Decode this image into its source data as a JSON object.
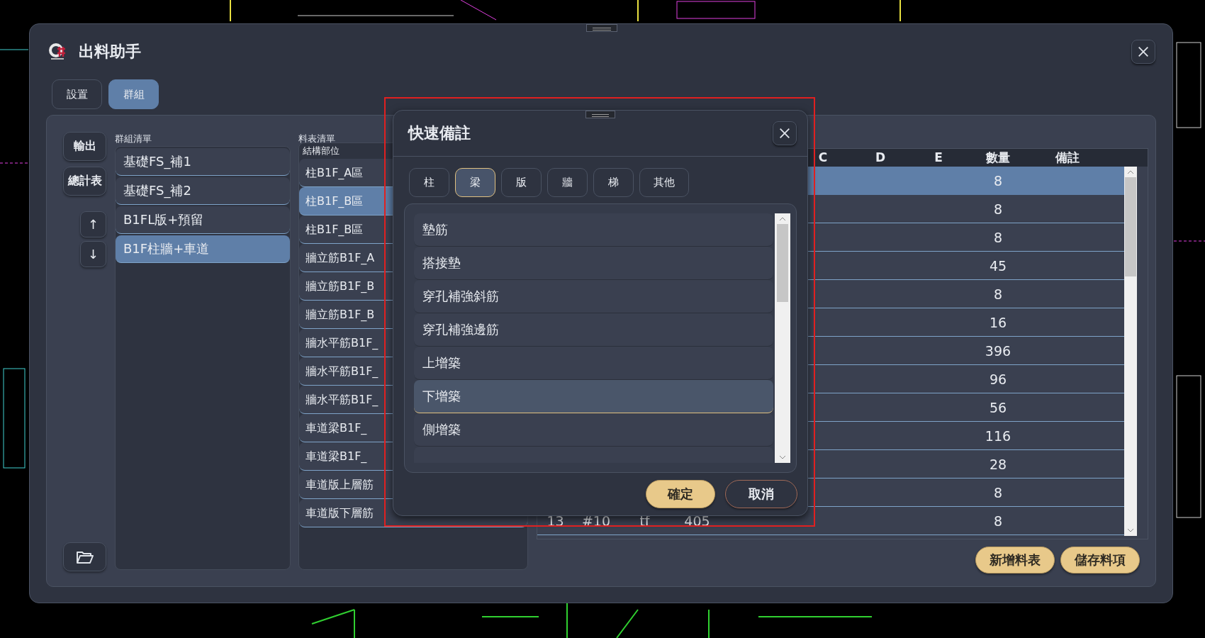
{
  "window": {
    "title": "出料助手"
  },
  "tabs": [
    {
      "label": "設置",
      "selected": false
    },
    {
      "label": "群組",
      "selected": true
    }
  ],
  "side_buttons": [
    {
      "label": "輸出",
      "kind": "text"
    },
    {
      "label": "總計表",
      "kind": "text"
    },
    {
      "label": "↑",
      "kind": "arrow"
    },
    {
      "label": "↓",
      "kind": "arrow"
    }
  ],
  "group_list": {
    "label": "群組清單",
    "items": [
      {
        "label": "基礎FS_補1",
        "selected": false
      },
      {
        "label": "基礎FS_補2",
        "selected": false
      },
      {
        "label": "B1FL版+預留",
        "selected": false
      },
      {
        "label": "B1F柱牆+車道",
        "selected": true
      }
    ]
  },
  "sheet_list": {
    "label": "料表清單",
    "column_header": "結構部位",
    "items": [
      {
        "label": "柱B1F_A區",
        "selected": false
      },
      {
        "label": "柱B1F_B區",
        "selected": true
      },
      {
        "label": "柱B1F_B區",
        "selected": false
      },
      {
        "label": "牆立筋B1F_A",
        "selected": false
      },
      {
        "label": "牆立筋B1F_B",
        "selected": false
      },
      {
        "label": "牆立筋B1F_B",
        "selected": false
      },
      {
        "label": "牆水平筋B1F_",
        "selected": false
      },
      {
        "label": "牆水平筋B1F_",
        "selected": false
      },
      {
        "label": "牆水平筋B1F_",
        "selected": false
      },
      {
        "label": "車道梁B1F_",
        "selected": false
      },
      {
        "label": "車道梁B1F_",
        "selected": false
      },
      {
        "label": "車道版上層筋",
        "selected": false
      },
      {
        "label": "車道版下層筋",
        "selected": false
      }
    ]
  },
  "table": {
    "columns": [
      "C",
      "D",
      "E",
      "數量",
      "備註"
    ],
    "rows": [
      {
        "selected": true,
        "quantity": "8"
      },
      {
        "selected": false,
        "quantity": "8"
      },
      {
        "selected": false,
        "quantity": "8"
      },
      {
        "selected": false,
        "quantity": "45"
      },
      {
        "selected": false,
        "quantity": "8"
      },
      {
        "selected": false,
        "quantity": "16"
      },
      {
        "selected": false,
        "quantity": "396"
      },
      {
        "selected": false,
        "quantity": "96"
      },
      {
        "selected": false,
        "quantity": "56"
      },
      {
        "selected": false,
        "quantity": "116"
      },
      {
        "selected": false,
        "quantity": "28"
      },
      {
        "selected": false,
        "quantity": "8"
      },
      {
        "selected": false,
        "column_1": "13",
        "column_2": "#10",
        "column_3": "tf",
        "column_4": "405",
        "quantity": "8"
      }
    ]
  },
  "footer_buttons": [
    "新增料表",
    "儲存料項"
  ],
  "dialog": {
    "title": "快速備註",
    "tabs": [
      {
        "label": "柱",
        "selected": false
      },
      {
        "label": "梁",
        "selected": true
      },
      {
        "label": "版",
        "selected": false
      },
      {
        "label": "牆",
        "selected": false
      },
      {
        "label": "梯",
        "selected": false
      },
      {
        "label": "其他",
        "selected": false
      }
    ],
    "items": [
      {
        "label": "墊筋",
        "selected": false
      },
      {
        "label": "搭接墊",
        "selected": false
      },
      {
        "label": "穿孔補強斜筋",
        "selected": false
      },
      {
        "label": "穿孔補強邊筋",
        "selected": false
      },
      {
        "label": "上增築",
        "selected": false
      },
      {
        "label": "下增築",
        "selected": true
      },
      {
        "label": "側增築",
        "selected": false
      }
    ],
    "buttons": [
      {
        "label": "確定",
        "kind": "primary"
      },
      {
        "label": "取消",
        "kind": "secondary"
      }
    ]
  }
}
